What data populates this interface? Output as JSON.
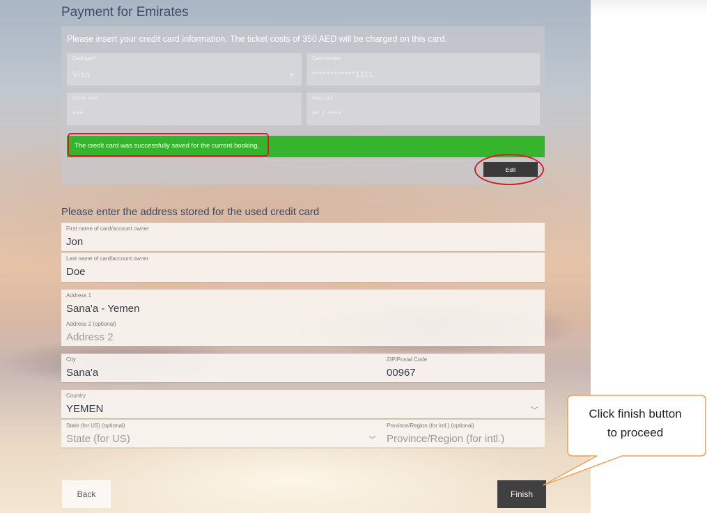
{
  "page": {
    "title": "Payment for Emirates"
  },
  "card": {
    "instructions": "Please insert your credit card information. The ticket costs of 350 AED will be charged on this card.",
    "card_type": {
      "label": "Card type*",
      "value": "Visa"
    },
    "card_number": {
      "label": "Card number",
      "value": "************1111"
    },
    "check_code": {
      "label": "Check code",
      "value": "***"
    },
    "valid_until": {
      "label": "Valid until",
      "value": "** / ****"
    },
    "success_message": "The credit card was successfully saved for the current booking.",
    "edit_label": "Edit"
  },
  "address": {
    "heading": "Please enter the address stored for the used credit card",
    "first_name": {
      "label": "First name of card/account owner",
      "value": "Jon"
    },
    "last_name": {
      "label": "Last name of card/account owner",
      "value": "Doe"
    },
    "address1": {
      "label": "Address 1",
      "value": "Sana'a - Yemen"
    },
    "address2": {
      "label": "Address 2 (optional)",
      "placeholder": "Address 2"
    },
    "city": {
      "label": "City",
      "value": "Sana'a"
    },
    "zip": {
      "label": "ZIP/Postal Code",
      "value": "00967"
    },
    "country": {
      "label": "Country",
      "value": "YEMEN"
    },
    "state": {
      "label": "State (for US) (optional)",
      "placeholder": "State (for US)"
    },
    "province": {
      "label": "Province/Region (for intl.) (optional)",
      "placeholder": "Province/Region (for intl.)"
    }
  },
  "buttons": {
    "back_label": "Back",
    "finish_label": "Finish"
  },
  "callout": {
    "line1": "Click finish button",
    "line2": "to proceed"
  },
  "colors": {
    "success": "#36b42e",
    "highlight_ring": "#d41f26",
    "callout_border": "#f0a050",
    "button_dark": "#404040"
  }
}
